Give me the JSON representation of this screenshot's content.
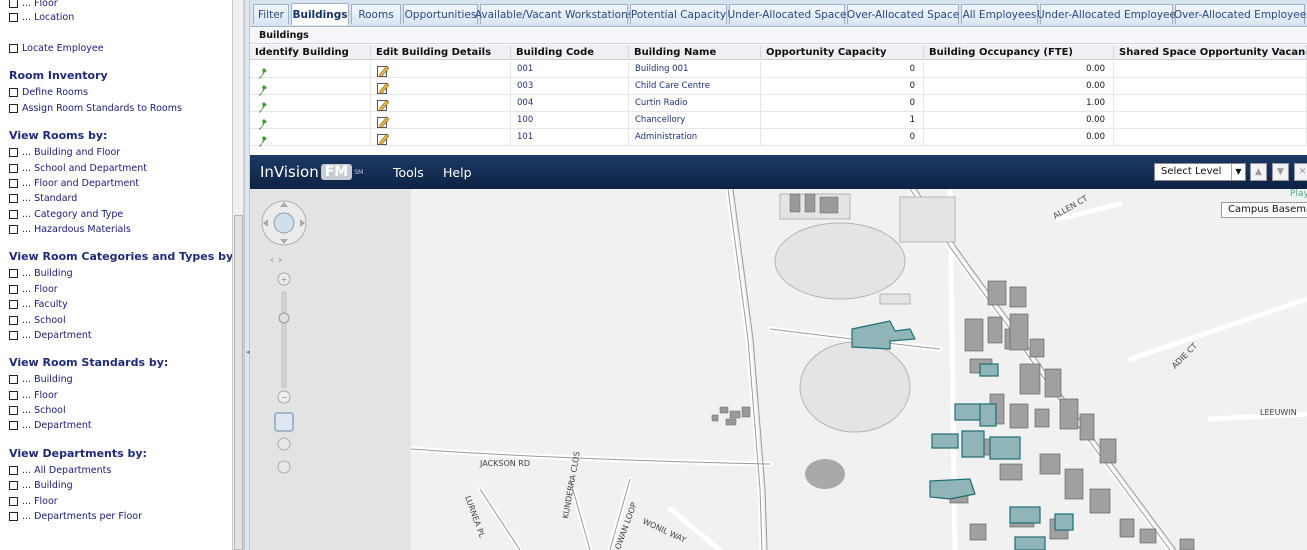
{
  "sidebar": {
    "top_items": [
      "... Floor",
      "... Location"
    ],
    "locate_employee": "Locate Employee",
    "groups": [
      {
        "title": "Room Inventory",
        "items": [
          "Define Rooms",
          "Assign Room Standards to Rooms"
        ]
      },
      {
        "title": "View Rooms by:",
        "items": [
          "... Building and Floor",
          "... School and Department",
          "... Floor and Department",
          "... Standard",
          "... Category and Type",
          "... Hazardous Materials"
        ]
      },
      {
        "title": "View Room Categories and Types by:",
        "items": [
          "... Building",
          "... Floor",
          "... Faculty",
          "... School",
          "... Department"
        ]
      },
      {
        "title": "View Room Standards by:",
        "items": [
          "... Building",
          "... Floor",
          "... School",
          "... Department"
        ]
      },
      {
        "title": "View Departments by:",
        "items": [
          "... All Departments",
          "... Building",
          "... Floor",
          "... Departments per Floor"
        ]
      }
    ]
  },
  "tabs": [
    "Filter",
    "Buildings",
    "Rooms",
    "Opportunities",
    "Available/Vacant Workstations",
    "Potential Capacity",
    "Under-Allocated Space",
    "Over-Allocated Space",
    "All Employees",
    "Under-Allocated Employee",
    "Over-Allocated Employee"
  ],
  "active_tab": "Buildings",
  "grid": {
    "title": "Buildings",
    "columns": [
      "Identify Building",
      "Edit Building Details",
      "Building Code",
      "Building Name",
      "Opportunity Capacity",
      "Building Occupancy (FTE)",
      "Shared Space Opportunity Vacancy"
    ],
    "rows": [
      {
        "code": "001",
        "name": "Building 001",
        "capacity": "0",
        "occupancy": "0.00"
      },
      {
        "code": "003",
        "name": "Child Care Centre",
        "capacity": "0",
        "occupancy": "0.00"
      },
      {
        "code": "004",
        "name": "Curtin Radio",
        "capacity": "0",
        "occupancy": "1.00"
      },
      {
        "code": "100",
        "name": "Chancellory",
        "capacity": "1",
        "occupancy": "0.00"
      },
      {
        "code": "101",
        "name": "Administration",
        "capacity": "0",
        "occupancy": "0.00"
      }
    ]
  },
  "map_toolbar": {
    "logo_text": "InVision",
    "logo_badge": "FM",
    "logo_sup": "SM",
    "menus": [
      "Tools",
      "Help"
    ],
    "level_select": "Select Level",
    "nav_up": "▲",
    "nav_down": "▼",
    "close": "✕"
  },
  "map": {
    "basemap_label": "Campus Basema",
    "play_label": "Play",
    "road_labels": [
      "ALLEN CT",
      "ADIE CT",
      "LEEUWIN",
      "JACKSON RD",
      "LURNEA PL",
      "KUNDERRA CLOS",
      "WONIL WAY",
      "OWAN LOOP"
    ],
    "colors": {
      "highlight": "#8fb5b8",
      "building": "#9a9a9a",
      "road": "#ffffff",
      "ground": "#f0f0f0"
    }
  }
}
